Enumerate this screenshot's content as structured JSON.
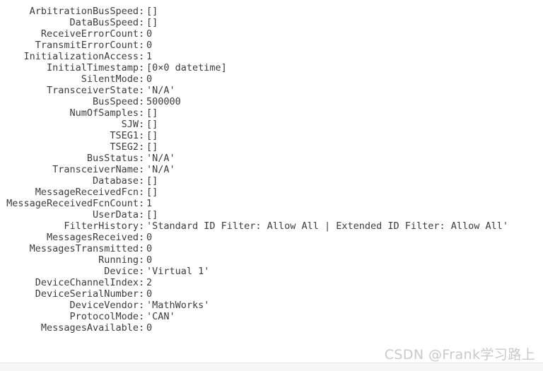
{
  "console": {
    "kind": "matlab-object-property-dump",
    "object_type": "can.Channel",
    "properties": [
      {
        "name": "ArbitrationBusSpeed",
        "separator": ":",
        "value": "[]"
      },
      {
        "name": "DataBusSpeed",
        "separator": ":",
        "value": "[]"
      },
      {
        "name": "ReceiveErrorCount",
        "separator": ":",
        "value": "0"
      },
      {
        "name": "TransmitErrorCount",
        "separator": ":",
        "value": "0"
      },
      {
        "name": "InitializationAccess",
        "separator": ":",
        "value": "1"
      },
      {
        "name": "InitialTimestamp",
        "separator": ":",
        "value": "[0×0 datetime]"
      },
      {
        "name": "SilentMode",
        "separator": ":",
        "value": "0"
      },
      {
        "name": "TransceiverState",
        "separator": ":",
        "value": "'N/A'"
      },
      {
        "name": "BusSpeed",
        "separator": ":",
        "value": "500000"
      },
      {
        "name": "NumOfSamples",
        "separator": ":",
        "value": "[]"
      },
      {
        "name": "SJW",
        "separator": ":",
        "value": "[]"
      },
      {
        "name": "TSEG1",
        "separator": ":",
        "value": "[]"
      },
      {
        "name": "TSEG2",
        "separator": ":",
        "value": "[]"
      },
      {
        "name": "BusStatus",
        "separator": ":",
        "value": "'N/A'"
      },
      {
        "name": "TransceiverName",
        "separator": ":",
        "value": "'N/A'"
      },
      {
        "name": "Database",
        "separator": ":",
        "value": "[]"
      },
      {
        "name": "MessageReceivedFcn",
        "separator": ":",
        "value": "[]"
      },
      {
        "name": "MessageReceivedFcnCount",
        "separator": ":",
        "value": "1"
      },
      {
        "name": "UserData",
        "separator": ":",
        "value": "[]"
      },
      {
        "name": "FilterHistory",
        "separator": ":",
        "value": "'Standard ID Filter: Allow All | Extended ID Filter: Allow All'"
      },
      {
        "name": "MessagesReceived",
        "separator": ":",
        "value": "0"
      },
      {
        "name": "MessagesTransmitted",
        "separator": ":",
        "value": "0"
      },
      {
        "name": "Running",
        "separator": ":",
        "value": "0"
      },
      {
        "name": "Device",
        "separator": ":",
        "value": "'Virtual 1'"
      },
      {
        "name": "DeviceChannelIndex",
        "separator": ":",
        "value": "2"
      },
      {
        "name": "DeviceSerialNumber",
        "separator": ":",
        "value": "0"
      },
      {
        "name": "DeviceVendor",
        "separator": ":",
        "value": "'MathWorks'"
      },
      {
        "name": "ProtocolMode",
        "separator": ":",
        "value": "'CAN'"
      },
      {
        "name": "MessagesAvailable",
        "separator": ":",
        "value": "0"
      }
    ]
  },
  "watermark": {
    "text": "CSDN @Frank学习路上"
  },
  "colors": {
    "background": "#ffffff",
    "text": "#3c3c3c",
    "watermark": "#c9c9c9",
    "divider": "#e8e8e8",
    "bottom_strip": "#f7f7f7"
  }
}
